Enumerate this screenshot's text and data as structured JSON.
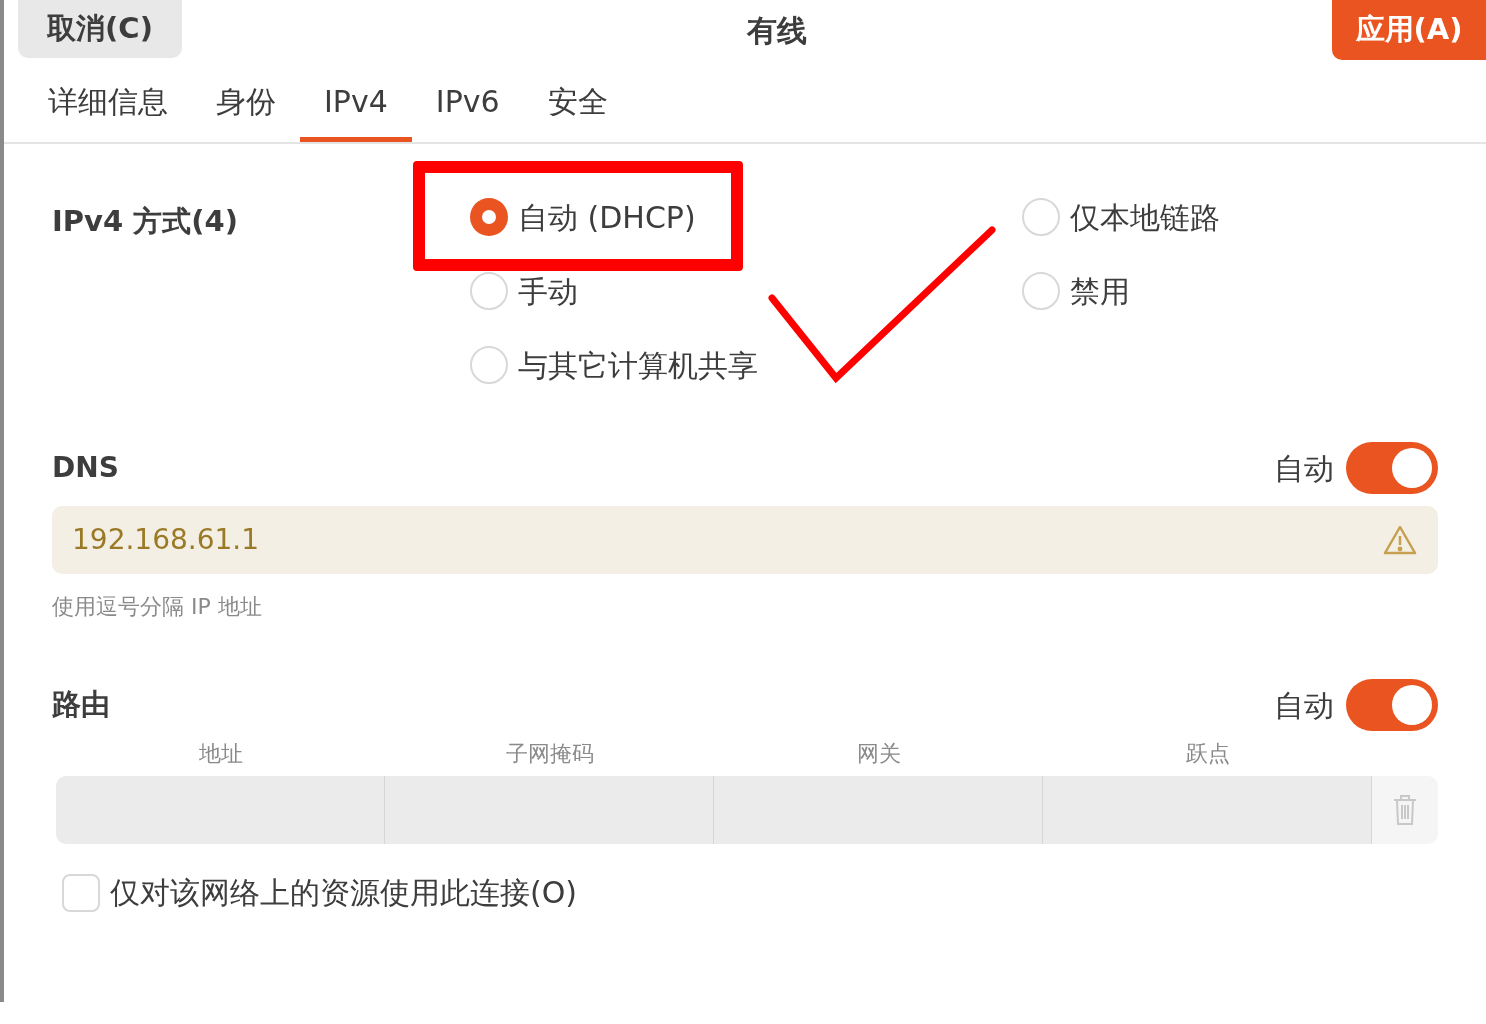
{
  "header": {
    "cancel": "取消(C)",
    "title": "有线",
    "apply": "应用(A)"
  },
  "tabs": [
    {
      "label": "详细信息",
      "selected": false
    },
    {
      "label": "身份",
      "selected": false
    },
    {
      "label": "IPv4",
      "selected": true
    },
    {
      "label": "IPv6",
      "selected": false
    },
    {
      "label": "安全",
      "selected": false
    }
  ],
  "method": {
    "label": "IPv4 方式(4)",
    "options": [
      {
        "label": "自动 (DHCP)",
        "selected": true
      },
      {
        "label": "仅本地链路",
        "selected": false
      },
      {
        "label": "手动",
        "selected": false
      },
      {
        "label": "禁用",
        "selected": false
      },
      {
        "label": "与其它计算机共享",
        "selected": false
      }
    ]
  },
  "dns": {
    "title": "DNS",
    "auto_label": "自动",
    "auto": true,
    "value": "192.168.61.1",
    "warning": true,
    "hint": "使用逗号分隔 IP 地址"
  },
  "routes": {
    "title": "路由",
    "auto_label": "自动",
    "auto": true,
    "columns": [
      "地址",
      "子网掩码",
      "网关",
      "跃点"
    ]
  },
  "only_local": {
    "label": "仅对该网络上的资源使用此连接(O)",
    "checked": false
  },
  "annotations": {
    "highlight_box": true,
    "checkmark": true
  }
}
